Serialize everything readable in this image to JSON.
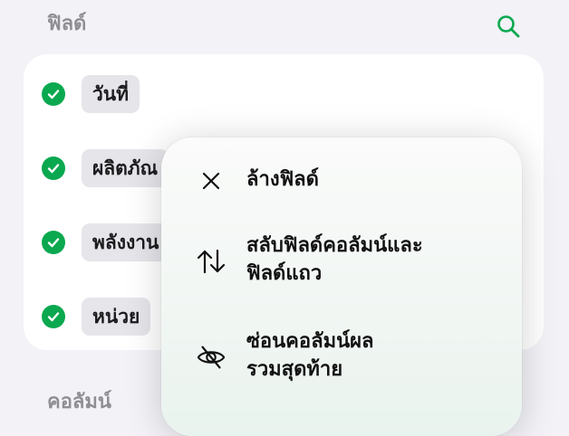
{
  "headers": {
    "fields": "ฟิลด์",
    "columns": "คอลัมน์"
  },
  "fields": [
    {
      "label": "วันที่",
      "checked": true
    },
    {
      "label": "ผลิตภัณ",
      "checked": true
    },
    {
      "label": "พลังงาน",
      "checked": true
    },
    {
      "label": "หน่วย",
      "checked": true
    }
  ],
  "menu": {
    "items": [
      {
        "label": "ล้างฟิลด์",
        "icon": "close-icon"
      },
      {
        "label_line1": "สลับฟิลด์คอลัมน์และ",
        "label_line2": "ฟิลด์แถว",
        "icon": "swap-arrows-icon"
      },
      {
        "label_line1": "ซ่อนคอลัมน์ผล",
        "label_line2": "รวมสุดท้าย",
        "icon": "eye-slash-icon"
      }
    ]
  },
  "colors": {
    "accent": "#0aa84f",
    "background": "#f2f2f7",
    "card": "#ffffff",
    "chip": "#e5e5ea",
    "header": "#8e8e93"
  }
}
